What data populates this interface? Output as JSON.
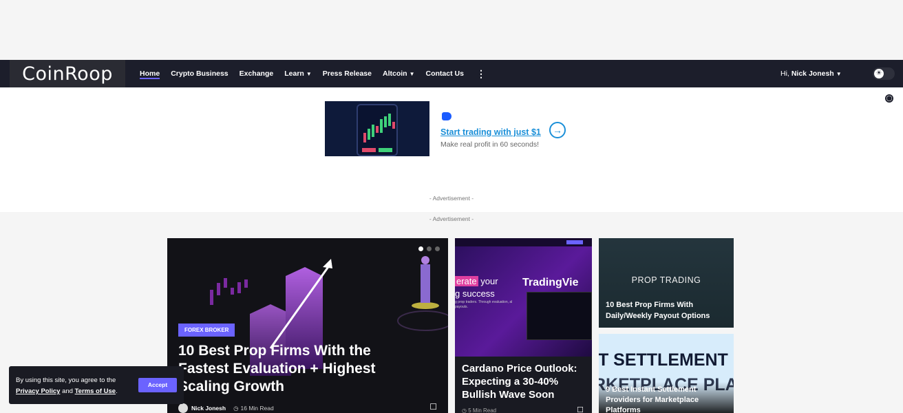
{
  "site": {
    "logo": "CoinRoop"
  },
  "nav": {
    "items": [
      {
        "label": "Home",
        "active": true,
        "dropdown": false
      },
      {
        "label": "Crypto Business",
        "active": false,
        "dropdown": false
      },
      {
        "label": "Exchange",
        "active": false,
        "dropdown": false
      },
      {
        "label": "Learn",
        "active": false,
        "dropdown": true
      },
      {
        "label": "Press Release",
        "active": false,
        "dropdown": false
      },
      {
        "label": "Altcoin",
        "active": false,
        "dropdown": true
      },
      {
        "label": "Contact Us",
        "active": false,
        "dropdown": false
      }
    ],
    "more_icon": "more-vertical-icon",
    "user_greeting": "Hi,",
    "user_name": "Nick Jonesh",
    "theme_toggle_icon": "sun-icon"
  },
  "ad": {
    "headline": "Start trading with just $1",
    "subtext": "Make real profit in 60 seconds!",
    "label_top": "- Advertisement -",
    "label_bottom": "- Advertisement -"
  },
  "hero": {
    "badge": "FOREX BROKER",
    "title": "10 Best Prop Firms With the Fastest Evaluation + Highest Scaling Growth",
    "author": "Nick Jonesh",
    "read_time": "16 Min Read",
    "slides": 3,
    "active_slide": 1
  },
  "card2": {
    "image_text_highlight": "erate",
    "image_text_rest": " your",
    "image_text_line2": "g success",
    "image_text_small": "g prop traders. Through evaluation, al payouts.",
    "image_brand": "TradingVie",
    "title": "Cardano Price Outlook: Expecting a 30-40% Bullish Wave Soon",
    "read_time": "5 Min Read"
  },
  "card3": {
    "image_label": "PROP TRADING",
    "title": "10 Best Prop Firms With Daily/Weekly Payout Options"
  },
  "card4": {
    "image_text_1": "IT SETTLEMENT",
    "image_text_2": "RKETPLACE PLA",
    "title": "9 Best Instant Settlement Providers for Marketplace Platforms"
  },
  "cookie": {
    "text_before": "By using this site, you agree to the",
    "privacy": "Privacy Policy",
    "and": "and",
    "terms": "Terms of Use",
    "period": ".",
    "accept": "Accept"
  },
  "colors": {
    "accent": "#6b63ff",
    "nav_bg": "#1c1e2b",
    "ad_link": "#1a8fd8"
  }
}
